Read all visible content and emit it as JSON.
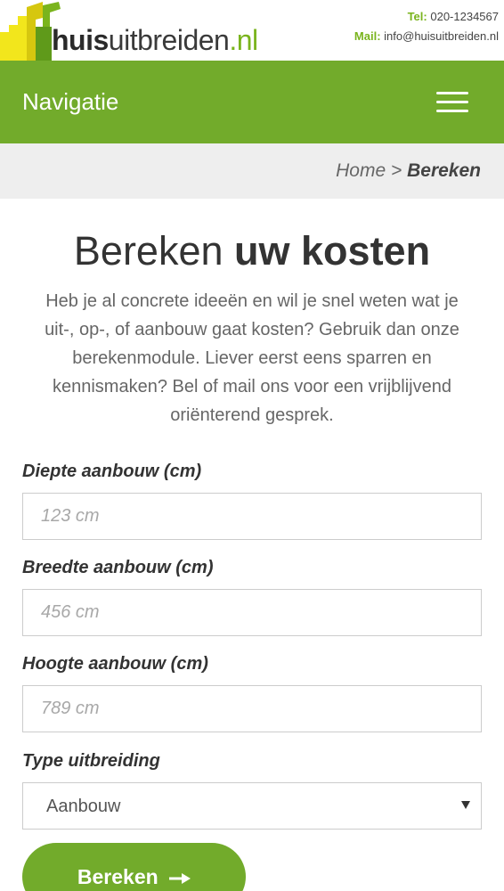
{
  "brand": {
    "logo_part1": "huis",
    "logo_part2": "uitbreiden",
    "logo_part3": ".nl",
    "colors": {
      "green": "#72ab2b",
      "lime": "#7ab41d",
      "yellow": "#f2e61c"
    }
  },
  "contact": {
    "tel_label": "Tel:",
    "tel_value": "020-1234567",
    "mail_label": "Mail:",
    "mail_value": "info@huisuitbreiden.nl"
  },
  "nav": {
    "title": "Navigatie",
    "menu_icon": "hamburger-menu-icon"
  },
  "breadcrumb": {
    "home": "Home",
    "separator": ">",
    "current": "Bereken"
  },
  "main": {
    "title_light": "Bereken",
    "title_bold": "uw kosten",
    "intro": "Heb je al concrete ideeën en wil je snel weten wat je uit-, op-, of aanbouw gaat kosten? Gebruik dan onze berekenmodule. Liever eerst eens sparren en kennismaken? Bel of mail ons voor een vrijblijvend oriënterend gesprek."
  },
  "form": {
    "depth": {
      "label": "Diepte aanbouw (cm)",
      "placeholder": "123 cm",
      "value": ""
    },
    "width": {
      "label": "Breedte aanbouw (cm)",
      "placeholder": "456 cm",
      "value": ""
    },
    "height": {
      "label": "Hoogte aanbouw (cm)",
      "placeholder": "789 cm",
      "value": ""
    },
    "type": {
      "label": "Type uitbreiding",
      "selected": "Aanbouw",
      "icon": "caret-down-icon"
    },
    "submit_label": "Bereken",
    "submit_icon": "arrow-right-icon"
  }
}
